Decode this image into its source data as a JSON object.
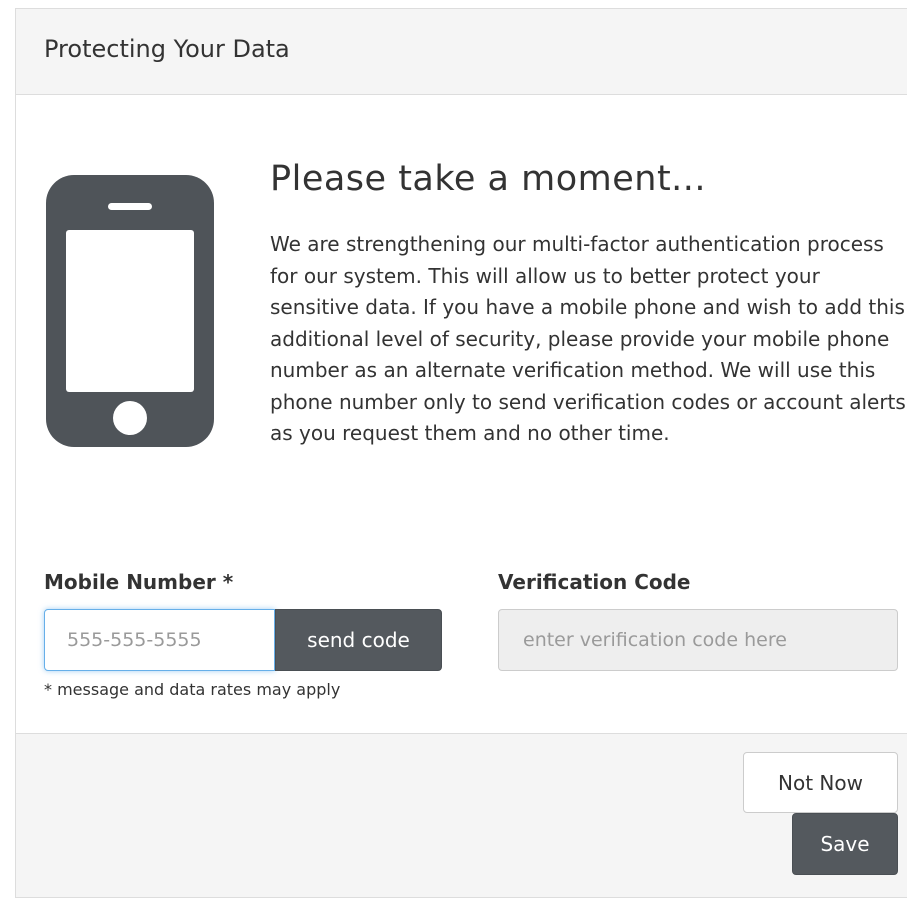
{
  "header": {
    "title": "Protecting Your Data"
  },
  "icons": {
    "phone": "mobile-phone-icon"
  },
  "colors": {
    "icon": "#4f5459",
    "button_dark": "#54595e",
    "focus": "#66afe9",
    "header_bg": "#f5f5f5"
  },
  "main": {
    "heading": "Please take a moment...",
    "intro": "We are strengthening our multi-factor authentication process for our system. This will allow us to better protect your sensitive data. If you have a mobile phone and wish to add this additional level of security, please provide your mobile phone number as an alternate verification method. We will use this phone number only to send verification codes or account alerts as you request them and no other time."
  },
  "form": {
    "mobile_label": "Mobile Number *",
    "mobile_value": "",
    "mobile_placeholder": "555-555-5555",
    "send_code_label": "send code",
    "code_label": "Verification Code",
    "code_value": "",
    "code_placeholder": "enter verification code here",
    "note": "* message and data rates may apply"
  },
  "footer": {
    "not_now_label": "Not Now",
    "save_label": "Save"
  }
}
